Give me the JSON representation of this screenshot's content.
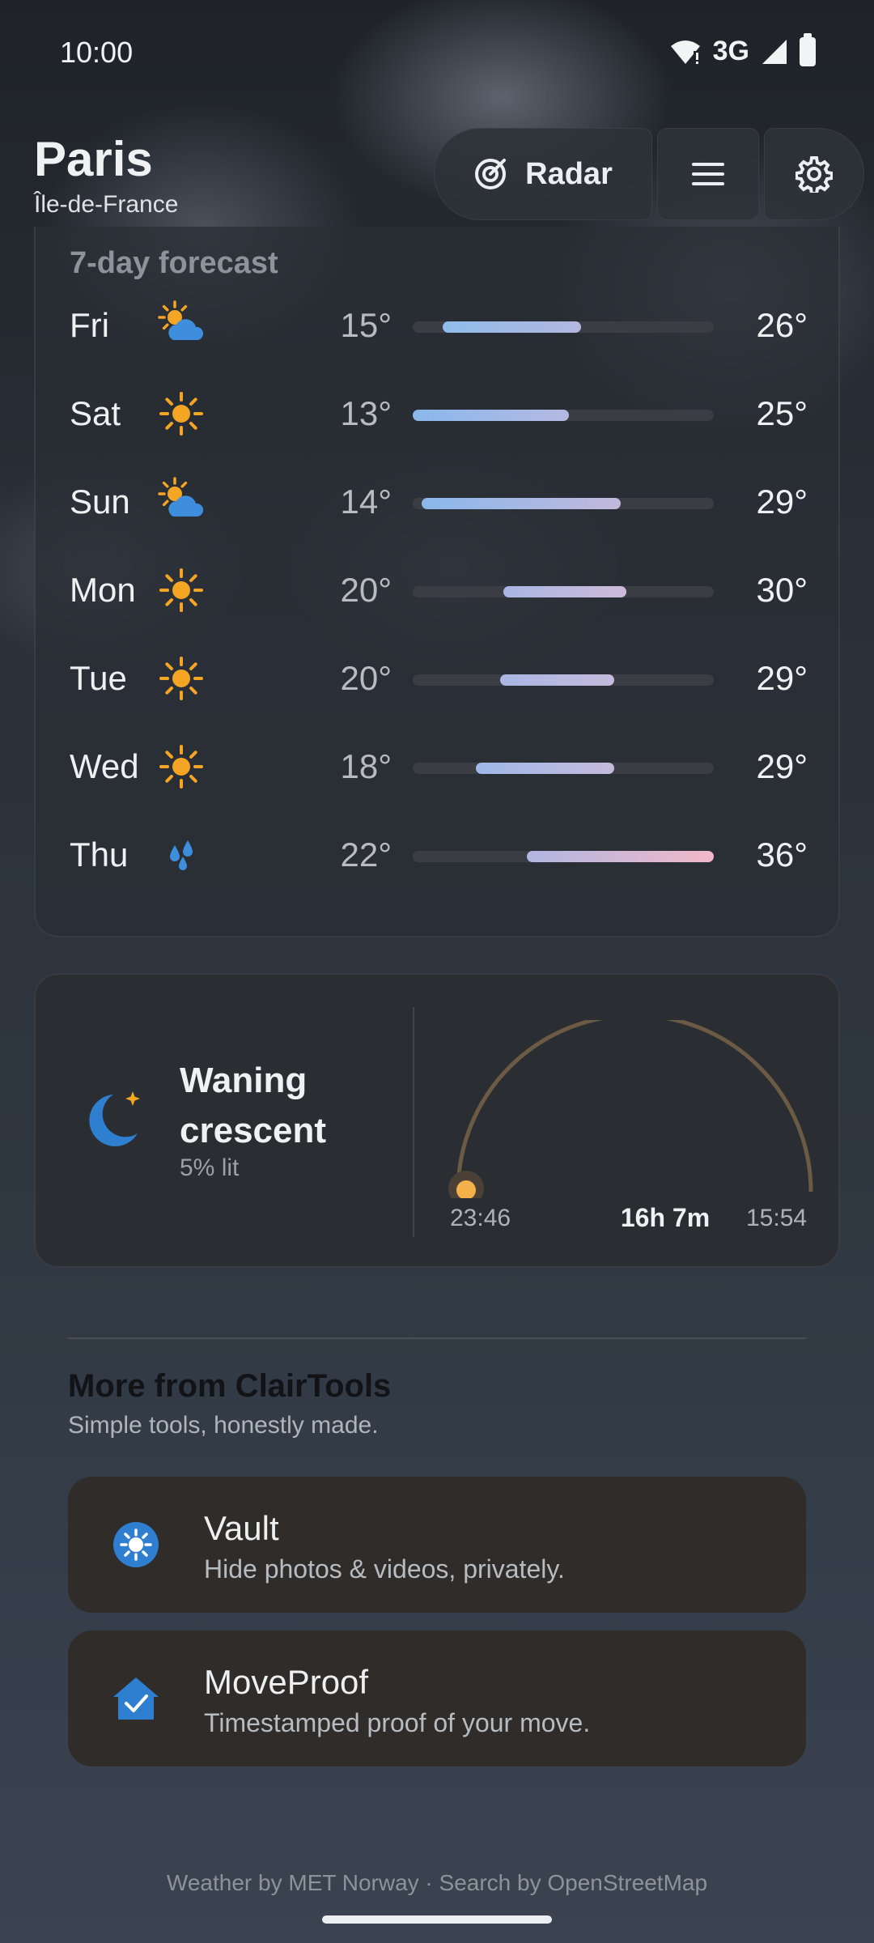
{
  "status_bar": {
    "time": "10:00",
    "network": "3G"
  },
  "header": {
    "city": "Paris",
    "region": "Île-de-France",
    "radar_label": "Radar"
  },
  "forecast": {
    "title": "7-day forecast",
    "days": [
      {
        "day": "Fri",
        "icon": "sun-behind-cloud-icon",
        "low": "15°",
        "high": "26°",
        "range_start": 0.1,
        "range_end": 0.56,
        "gradient": [
          "#8fbcea",
          "#b3b7e0"
        ]
      },
      {
        "day": "Sat",
        "icon": "sun-icon",
        "low": "13°",
        "high": "25°",
        "range_start": 0.0,
        "range_end": 0.52,
        "gradient": [
          "#8ab8ec",
          "#b5b9e2"
        ]
      },
      {
        "day": "Sun",
        "icon": "sun-behind-cloud-icon",
        "low": "14°",
        "high": "29°",
        "range_start": 0.03,
        "range_end": 0.69,
        "gradient": [
          "#8ab8ec",
          "#c2b8dc"
        ]
      },
      {
        "day": "Mon",
        "icon": "sun-icon",
        "low": "20°",
        "high": "30°",
        "range_start": 0.3,
        "range_end": 0.71,
        "gradient": [
          "#a9b6e4",
          "#cdbbd8"
        ]
      },
      {
        "day": "Tue",
        "icon": "sun-icon",
        "low": "20°",
        "high": "29°",
        "range_start": 0.29,
        "range_end": 0.67,
        "gradient": [
          "#a9b6e4",
          "#c5badc"
        ]
      },
      {
        "day": "Wed",
        "icon": "sun-icon",
        "low": "18°",
        "high": "29°",
        "range_start": 0.21,
        "range_end": 0.67,
        "gradient": [
          "#9fb8e8",
          "#c5badc"
        ]
      },
      {
        "day": "Thu",
        "icon": "raindrops-icon",
        "low": "22°",
        "high": "36°",
        "range_start": 0.38,
        "range_end": 1.0,
        "gradient": [
          "#b0b6e2",
          "#f2b8c8"
        ]
      }
    ]
  },
  "moon": {
    "phase": "Waning crescent",
    "lit": "5% lit",
    "rise": "23:46",
    "duration": "16h 7m",
    "set": "15:54"
  },
  "more": {
    "title": "More from ClairTools",
    "subtitle": "Simple tools, honestly made.",
    "apps": [
      {
        "name": "Vault",
        "desc": "Hide photos & videos, privately.",
        "icon": "vault-icon"
      },
      {
        "name": "MoveProof",
        "desc": "Timestamped proof of your move.",
        "icon": "house-check-icon"
      }
    ]
  },
  "footer": "Weather by MET Norway · Search by OpenStreetMap",
  "colors": {
    "sun": "#f5a524",
    "cloud_blue": "#3f8ede",
    "moon_blue": "#2f7fd0",
    "arc": "#6b5b44",
    "accent_blue": "#2f7fd0"
  }
}
